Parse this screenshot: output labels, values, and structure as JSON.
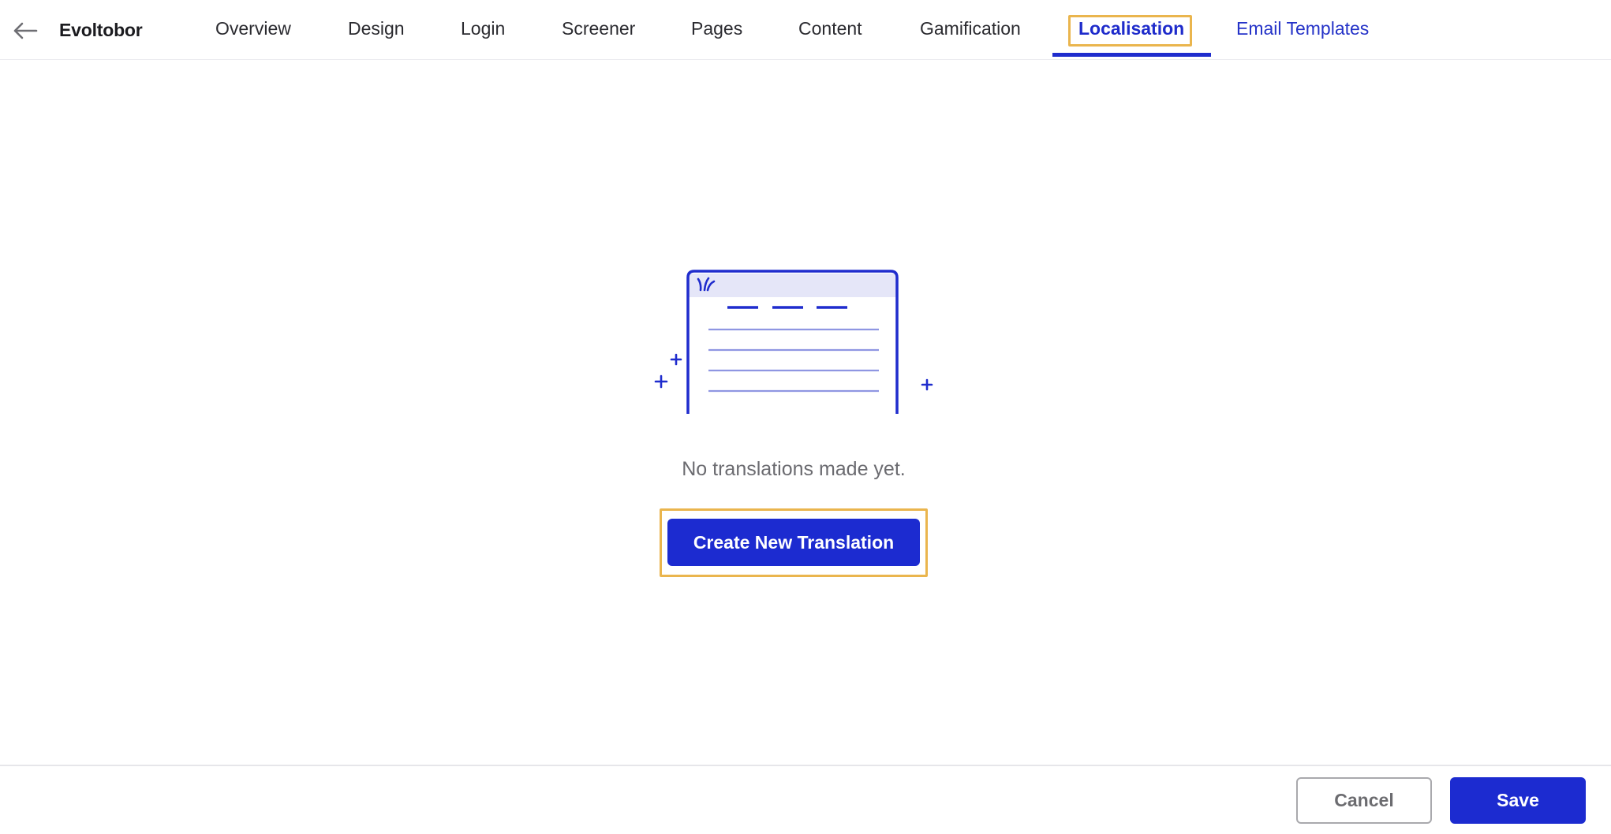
{
  "app": {
    "title": "Evoltobor",
    "back_icon": "arrow-left-icon"
  },
  "nav": {
    "tabs": [
      {
        "label": "Overview"
      },
      {
        "label": "Design"
      },
      {
        "label": "Login"
      },
      {
        "label": "Screener"
      },
      {
        "label": "Pages"
      },
      {
        "label": "Content"
      },
      {
        "label": "Gamification"
      },
      {
        "label": "Localisation",
        "active": true
      },
      {
        "label": "Email Templates"
      }
    ]
  },
  "empty_state": {
    "illustration_icon": "document-translation-illustration",
    "message": "No translations made yet.",
    "cta_label": "Create New Translation"
  },
  "footer": {
    "cancel_label": "Cancel",
    "save_label": "Save"
  },
  "colors": {
    "accent": "#1c2bd0",
    "highlight": "#eab54d",
    "muted_text": "#6b6b70"
  }
}
